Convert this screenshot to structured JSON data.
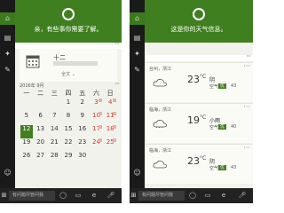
{
  "left": {
    "greeting": "亲，有些事你需要了解。",
    "date_card": {
      "day": "十二",
      "weekday": "",
      "more": "全文"
    },
    "calendar": {
      "month_label": "2016年 9月",
      "weekdays": [
        "一",
        "二",
        "三",
        "四",
        "五",
        "六",
        "日"
      ],
      "rows": [
        [
          {
            "d": "",
            "l": ""
          },
          {
            "d": "",
            "l": ""
          },
          {
            "d": "",
            "l": ""
          },
          {
            "d": "1",
            "l": ""
          },
          {
            "d": "2",
            "l": ""
          },
          {
            "d": "3",
            "l": ""
          },
          {
            "d": "4",
            "l": ""
          }
        ],
        [
          {
            "d": "5",
            "l": ""
          },
          {
            "d": "6",
            "l": ""
          },
          {
            "d": "7",
            "l": ""
          },
          {
            "d": "8",
            "l": ""
          },
          {
            "d": "9",
            "l": ""
          },
          {
            "d": "10",
            "l": ""
          },
          {
            "d": "11",
            "l": ""
          }
        ],
        [
          {
            "d": "12",
            "l": ""
          },
          {
            "d": "13",
            "l": ""
          },
          {
            "d": "14",
            "l": ""
          },
          {
            "d": "15",
            "l": ""
          },
          {
            "d": "16",
            "l": ""
          },
          {
            "d": "17",
            "l": ""
          },
          {
            "d": "18",
            "l": ""
          }
        ],
        [
          {
            "d": "19",
            "l": ""
          },
          {
            "d": "20",
            "l": ""
          },
          {
            "d": "21",
            "l": ""
          },
          {
            "d": "22",
            "l": ""
          },
          {
            "d": "23",
            "l": ""
          },
          {
            "d": "24",
            "l": ""
          },
          {
            "d": "25",
            "l": ""
          }
        ],
        [
          {
            "d": "26",
            "l": ""
          },
          {
            "d": "27",
            "l": ""
          },
          {
            "d": "28",
            "l": ""
          },
          {
            "d": "29",
            "l": ""
          },
          {
            "d": "30",
            "l": ""
          },
          {
            "d": "",
            "l": ""
          },
          {
            "d": "",
            "l": ""
          }
        ]
      ]
    },
    "search_placeholder": "有问题尽管问我"
  },
  "right": {
    "greeting": "这是你的天气信息。",
    "weather": [
      {
        "city": "台州，浙江",
        "temp": "23",
        "unit": "°C",
        "cond": "阴",
        "aq_label": "空气",
        "aq_badge": "优",
        "aq_value": "43"
      },
      {
        "city": "临海，浙江",
        "temp": "19",
        "unit": "°C",
        "cond": "小雨",
        "aq_label": "空气",
        "aq_badge": "优",
        "aq_value": "40"
      },
      {
        "city": "临海，浙江",
        "temp": "23",
        "unit": "°C",
        "cond": "阴",
        "aq_label": "空气",
        "aq_badge": "优",
        "aq_value": "43"
      }
    ],
    "search_placeholder": "有问题尽管问我"
  },
  "colors": {
    "accent": "#3f7f1f",
    "rail": "#1a1a1a",
    "taskbar": "#222222",
    "card": "#fbfbf6"
  }
}
